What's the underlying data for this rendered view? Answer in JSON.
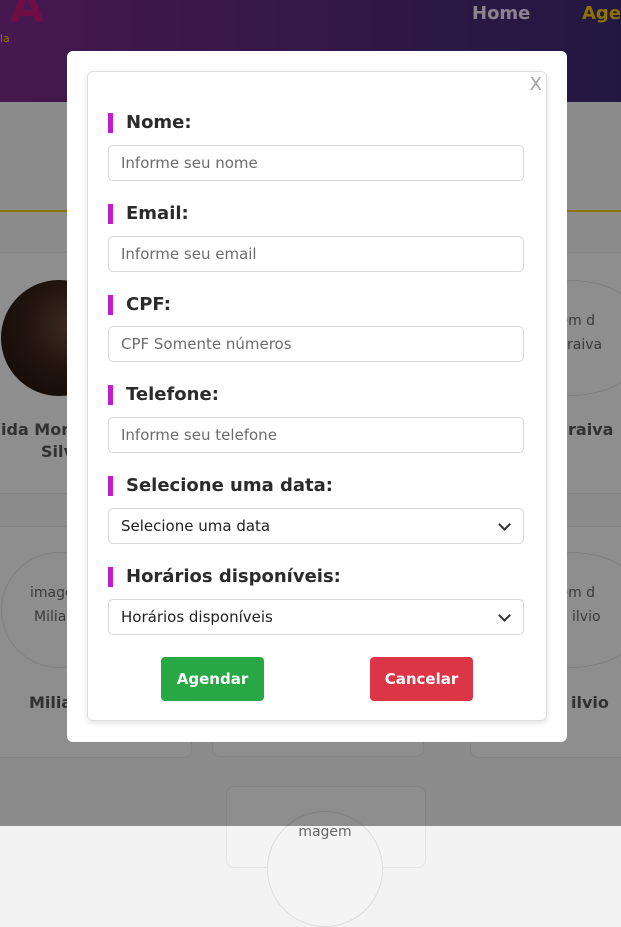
{
  "background": {
    "logo_text": "A",
    "logo_sub": "la",
    "nav": {
      "home": "Home",
      "agenda": "Agen"
    },
    "cards": [
      {
        "name_line1": "ida Mont",
        "name_line2": "Silv"
      },
      {
        "image_alt_line1": "agem d",
        "image_alt_line2": "raiva",
        "name": "raiva"
      },
      {
        "image_alt_line1": "image",
        "image_alt_line2": "Milia",
        "name": "Milia"
      },
      {
        "image_alt_line1": "agem d",
        "image_alt_line2": "ilvio",
        "name": "ilvio"
      },
      {
        "image_alt_line1": "magem"
      }
    ]
  },
  "modal": {
    "close_label": "X",
    "fields": {
      "nome": {
        "label": "Nome:",
        "placeholder": "Informe seu nome"
      },
      "email": {
        "label": "Email:",
        "placeholder": "Informe seu email"
      },
      "cpf": {
        "label": "CPF:",
        "placeholder": "CPF Somente números"
      },
      "telefone": {
        "label": "Telefone:",
        "placeholder": "Informe seu telefone"
      },
      "data": {
        "label": "Selecione uma data:",
        "selected": "Selecione uma data"
      },
      "horarios": {
        "label": "Horários disponíveis:",
        "selected": "Horários disponíveis"
      }
    },
    "buttons": {
      "agendar": "Agendar",
      "cancelar": "Cancelar"
    },
    "colors": {
      "accent_bar": "#c51ad0",
      "confirm": "#28a745",
      "cancel": "#dc3545"
    }
  }
}
